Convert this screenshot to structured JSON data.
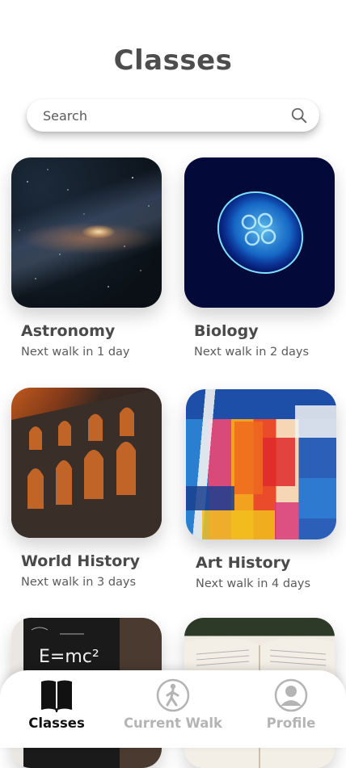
{
  "header": {
    "title": "Classes"
  },
  "search": {
    "placeholder": "Search",
    "icon": "search-icon"
  },
  "classes": [
    {
      "title": "Astronomy",
      "subtitle": "Next walk in 1 day"
    },
    {
      "title": "Biology",
      "subtitle": "Next walk in 2 days"
    },
    {
      "title": "World History",
      "subtitle": "Next walk in 3 days"
    },
    {
      "title": "Art History",
      "subtitle": "Next walk in 4 days"
    },
    {
      "title": "",
      "subtitle": ""
    },
    {
      "title": "",
      "subtitle": ""
    }
  ],
  "tabbar": {
    "active_tab": "Classes",
    "tabs": [
      {
        "label": "Classes",
        "icon": "book-icon",
        "active": true
      },
      {
        "label": "Current Walk",
        "icon": "walking-person-icon",
        "active": false
      },
      {
        "label": "Profile",
        "icon": "profile-icon",
        "active": false
      }
    ]
  },
  "colors": {
    "active_tab": "#111111",
    "inactive_tab": "#b4b4b4",
    "title": "#4d4d4d"
  },
  "board_text": "E=mc²"
}
